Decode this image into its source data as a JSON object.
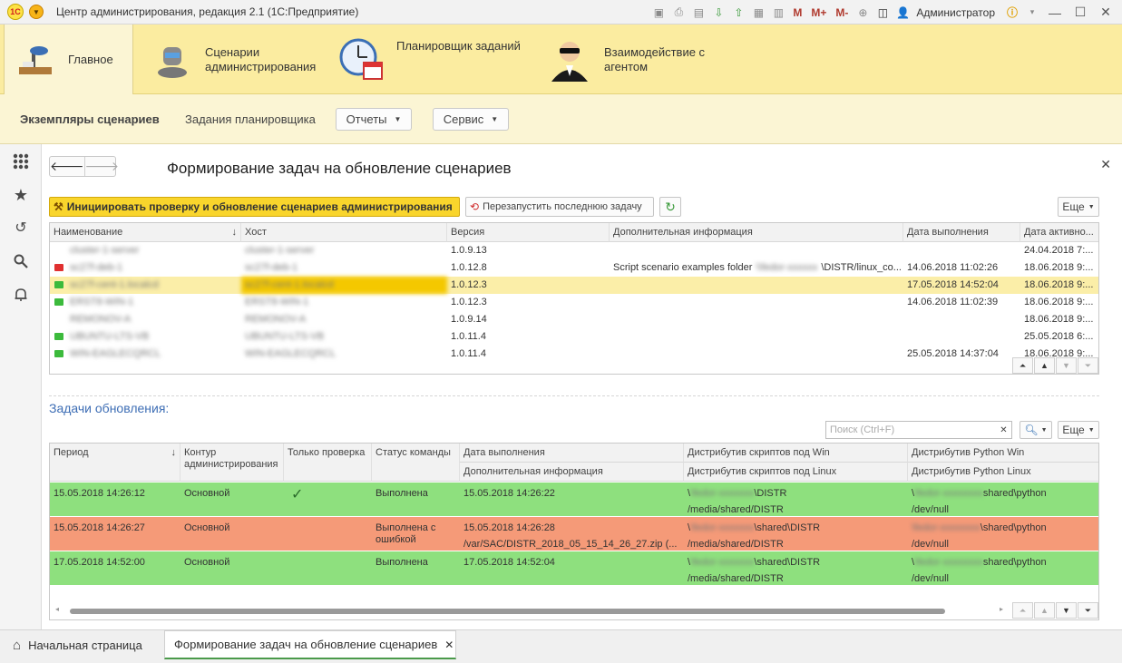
{
  "window": {
    "title": "Центр администрирования, редакция 2.1  (1С:Предприятие)",
    "logo_text": "1С",
    "user": "Администратор",
    "toolbar_m": [
      "M",
      "M+",
      "M-"
    ]
  },
  "sections": [
    {
      "label": "Главное",
      "icon": "desk-lamp-icon"
    },
    {
      "label": "Сценарии\nадминистрирования",
      "icon": "robot-icon"
    },
    {
      "label": "Планировщик заданий",
      "icon": "clock-calendar-icon"
    },
    {
      "label": "Взаимодействие с\nагентом",
      "icon": "agent-icon"
    }
  ],
  "subnav": {
    "item1": "Экземпляры сценариев",
    "item2": "Задания планировщика",
    "reports": "Отчеты",
    "service": "Сервис"
  },
  "form": {
    "title": "Формирование задач на обновление сценариев",
    "init_button": "Инициировать проверку и обновление сценариев администрирования",
    "restart_button": "Перезапустить последнюю задачу",
    "more1": "Еще",
    "more2": "Еще",
    "tasks_title": "Задачи обновления:",
    "search_placeholder": "Поиск (Ctrl+F)"
  },
  "grid1": {
    "headers": [
      "Наименование",
      "Хост",
      "Версия",
      "Дополнительная информация",
      "Дата выполнения",
      "Дата активно..."
    ],
    "rows": [
      {
        "name": "cluster-1-server",
        "host": "cluster-1-server",
        "version": "1.0.9.13",
        "info": "",
        "info_blur": "",
        "info_tail": "",
        "date": "",
        "active": "24.04.2018 7:...",
        "flag": "",
        "selected": false
      },
      {
        "name": "sc27f-deb-1",
        "host": "sc27f-deb-1",
        "version": "1.0.12.8",
        "info": "Script scenario examples folder",
        "info_blur": "\\\\fedor-xxxxxx",
        "info_tail": "\\DISTR/linux_co...",
        "date": "14.06.2018 11:02:26",
        "active": "18.06.2018 9:...",
        "flag": "#e03030",
        "selected": false
      },
      {
        "name": "sc27f-cent-1.localcd",
        "host": "sc27f-cent-1.localcd",
        "version": "1.0.12.3",
        "info": "",
        "info_blur": "",
        "info_tail": "",
        "date": "17.05.2018 14:52:04",
        "active": "18.06.2018 9:...",
        "flag": "#3cba3c",
        "selected": true
      },
      {
        "name": "ERST8-WIN-1",
        "host": "ERST8-WIN-1",
        "version": "1.0.12.3",
        "info": "",
        "info_blur": "",
        "info_tail": "",
        "date": "14.06.2018 11:02:39",
        "active": "18.06.2018 9:...",
        "flag": "#3cba3c",
        "selected": false
      },
      {
        "name": "REMONOV-A",
        "host": "REMONOV-A",
        "version": "1.0.9.14",
        "info": "",
        "info_blur": "",
        "info_tail": "",
        "date": "",
        "active": "18.06.2018 9:...",
        "flag": "",
        "selected": false
      },
      {
        "name": "UBUNTU-LTS-VB",
        "host": "UBUNTU-LTS-VB",
        "version": "1.0.11.4",
        "info": "",
        "info_blur": "",
        "info_tail": "",
        "date": "",
        "active": "25.05.2018 6:...",
        "flag": "#3cba3c",
        "selected": false
      },
      {
        "name": "WIN-EAGLECQRCL",
        "host": "WIN-EAGLECQRCL",
        "version": "1.0.11.4",
        "info": "",
        "info_blur": "",
        "info_tail": "",
        "date": "25.05.2018 14:37:04",
        "active": "18.06.2018 9:...",
        "flag": "#3cba3c",
        "selected": false
      }
    ]
  },
  "grid2": {
    "headers": {
      "period": "Период",
      "contour": "Контур\nадминистрирования",
      "check_only": "Только проверка",
      "status": "Статус команды",
      "exec_date": "Дата выполнения",
      "add_info": "Дополнительная информация",
      "dist_win": "Дистрибутив скриптов под Win",
      "dist_linux": "Дистрибутив скриптов под Linux",
      "py_win": "Дистрибутив Python Win",
      "py_linux": "Дистрибутив Python Linux"
    },
    "rows": [
      {
        "period": "15.05.2018 14:26:12",
        "contour": "Основной",
        "check": "✓",
        "status": "Выполнена",
        "date": "15.05.2018 14:26:22",
        "info": "",
        "win_prefix": "\\",
        "win_blur": "\\fedor-xxxxxxx",
        "win_tail": "\\DISTR",
        "linux": "/media/shared/DISTR",
        "py_prefix": "\\",
        "py_blur": "\\fedor-xxxxxxxx",
        "py_tail": "shared\\python",
        "py_linux": "/dev/null",
        "color": "#8ee07e"
      },
      {
        "period": "15.05.2018 14:26:27",
        "contour": "Основной",
        "check": "",
        "status": "Выполнена с ошибкой",
        "date": "15.05.2018 14:26:28",
        "info": "/var/SAC/DISTR_2018_05_15_14_26_27.zip (...",
        "win_prefix": "\\",
        "win_blur": "\\fedor-xxxxxxx",
        "win_tail": "\\shared\\DISTR",
        "linux": "/media/shared/DISTR",
        "py_prefix": "",
        "py_blur": "\\fedor-xxxxxxxx",
        "py_tail": "\\shared\\python",
        "py_linux": "/dev/null",
        "color": "#f59a78"
      },
      {
        "period": "17.05.2018 14:52:00",
        "contour": "Основной",
        "check": "",
        "status": "Выполнена",
        "date": "17.05.2018 14:52:04",
        "info": "",
        "win_prefix": "\\",
        "win_blur": "\\fedor-xxxxxxx",
        "win_tail": "\\shared\\DISTR",
        "linux": "/media/shared/DISTR",
        "py_prefix": "\\",
        "py_blur": "\\fedor-xxxxxxxx",
        "py_tail": "shared\\python",
        "py_linux": "/dev/null",
        "color": "#8ee07e"
      }
    ]
  },
  "tabs": {
    "home": "Начальная страница",
    "current": "Формирование задач на обновление сценариев"
  }
}
